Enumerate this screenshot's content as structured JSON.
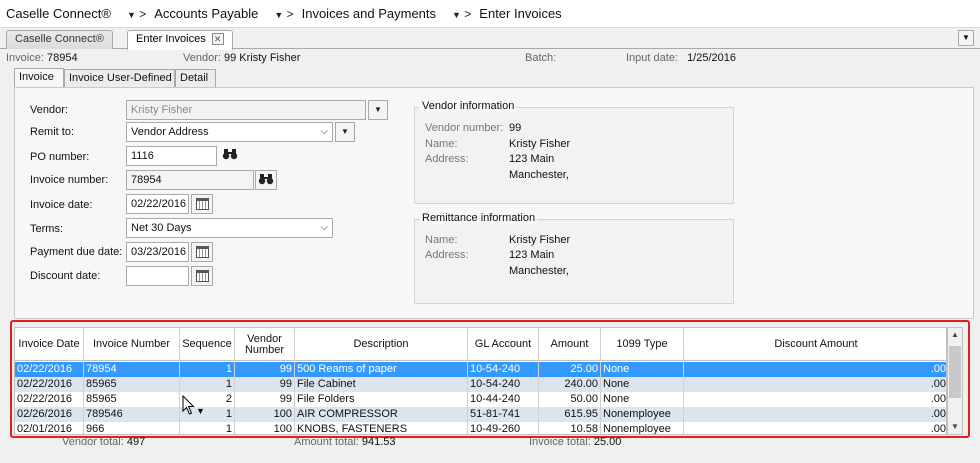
{
  "breadcrumb": {
    "items": [
      "Caselle Connect®",
      "Accounts Payable",
      "Invoices and Payments",
      "Enter Invoices"
    ],
    "separator": ">",
    "dropdown_glyph": "▼"
  },
  "tabs": [
    {
      "label": "Caselle Connect®",
      "active": false
    },
    {
      "label": "Enter Invoices",
      "active": true
    }
  ],
  "header": {
    "invoice_label": "Invoice:",
    "invoice_value": "78954",
    "vendor_label": "Vendor:",
    "vendor_value": "99  Kristy Fisher",
    "batch_label": "Batch:",
    "batch_value": "",
    "input_date_label": "Input date:",
    "input_date_value": "1/25/2016"
  },
  "subtabs": [
    {
      "label": "Invoice",
      "active": true
    },
    {
      "label": "Invoice User-Defined",
      "active": false
    },
    {
      "label": "Detail",
      "active": false
    }
  ],
  "form": {
    "vendor_label": "Vendor:",
    "vendor_value": "Kristy Fisher",
    "remit_label": "Remit to:",
    "remit_value": "Vendor Address",
    "po_label": "PO number:",
    "po_value": "1116",
    "invoice_number_label": "Invoice number:",
    "invoice_number_value": "78954",
    "invoice_date_label": "Invoice date:",
    "invoice_date_value": "02/22/2016",
    "terms_label": "Terms:",
    "terms_value": "Net 30 Days",
    "payment_due_label": "Payment due date:",
    "payment_due_value": "03/23/2016",
    "discount_date_label": "Discount date:",
    "discount_date_value": ""
  },
  "vendor_info": {
    "title": "Vendor information",
    "number_label": "Vendor number:",
    "number_value": "99",
    "name_label": "Name:",
    "name_value": "Kristy Fisher",
    "address_label": "Address:",
    "address_line1": "123 Main",
    "address_line2": "Manchester,"
  },
  "remit_info": {
    "title": "Remittance information",
    "name_label": "Name:",
    "name_value": "Kristy Fisher",
    "address_label": "Address:",
    "address_line1": "123 Main",
    "address_line2": "Manchester,"
  },
  "grid": {
    "columns": [
      "Invoice Date",
      "Invoice Number",
      "Sequence",
      "Vendor Number",
      "Description",
      "GL Account",
      "Amount",
      "1099 Type",
      "Discount Amount"
    ],
    "rows": [
      [
        "02/22/2016",
        "78954",
        "1",
        "99",
        "500 Reams of paper",
        "10-54-240",
        "25.00",
        "None",
        ".00"
      ],
      [
        "02/22/2016",
        "85965",
        "1",
        "99",
        "File Cabinet",
        "10-54-240",
        "240.00",
        "None",
        ".00"
      ],
      [
        "02/22/2016",
        "85965",
        "2",
        "99",
        "File Folders",
        "10-44-240",
        "50.00",
        "None",
        ".00"
      ],
      [
        "02/26/2016",
        "789546",
        "1",
        "100",
        "AIR COMPRESSOR",
        "51-81-741",
        "615.95",
        "Nonemployee",
        ".00"
      ],
      [
        "02/01/2016",
        "966",
        "1",
        "100",
        "KNOBS, FASTENERS",
        "10-49-260",
        "10.58",
        "Nonemployee",
        ".00"
      ]
    ],
    "selected_row": 0
  },
  "totals": {
    "vendor_label": "Vendor total:",
    "vendor_value": "497",
    "amount_label": "Amount total:",
    "amount_value": "941.53",
    "invoice_label": "Invoice total:",
    "invoice_value": "25.00"
  },
  "icons": {
    "binoculars": "binoculars-icon",
    "calendar": "calendar-icon",
    "dropdown": "chevron-down-icon",
    "close": "close-icon"
  },
  "colors": {
    "selection": "#3399ff",
    "alt_row": "#dde4f0",
    "highlight_box": "#e02020"
  }
}
